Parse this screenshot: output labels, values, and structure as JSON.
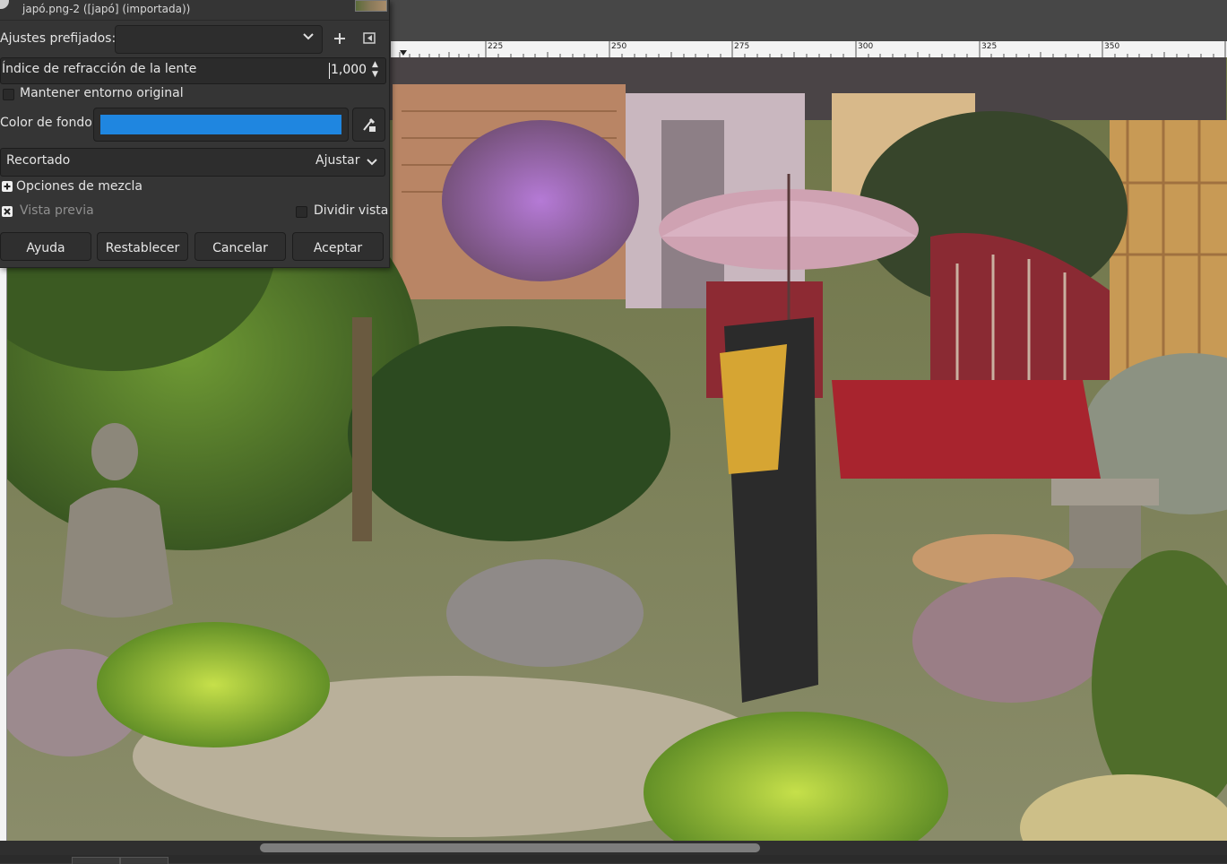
{
  "dialog": {
    "image_title": "japó.png-2 ([japó] (importada))",
    "presets_label": "Ajustes prefijados:",
    "presets_value": "",
    "add_preset_icon": "plus-icon",
    "manage_presets_icon": "triangle-left-icon",
    "refraction_label": "Índice de refracción de la lente",
    "refraction_value": "1,000",
    "keep_surroundings_label": "Mantener entorno original",
    "keep_surroundings_checked": false,
    "bg_color_label": "Color de fondo",
    "bg_color": "#1f86e0",
    "clipping_label": "Recortado",
    "clipping_value": "Ajustar",
    "blending_options_label": "Opciones de mezcla",
    "preview_label": "Vista previa",
    "preview_checked": true,
    "split_view_label": "Dividir vista",
    "split_view_checked": false,
    "buttons": {
      "help": "Ayuda",
      "reset": "Restablecer",
      "cancel": "Cancelar",
      "ok": "Aceptar"
    }
  },
  "ruler": {
    "ticks": [
      "225",
      "250",
      "275",
      "300",
      "325",
      "350"
    ]
  }
}
